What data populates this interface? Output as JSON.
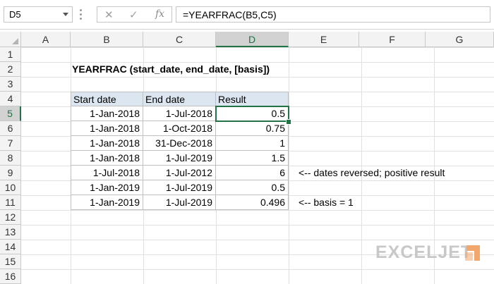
{
  "formula_bar": {
    "name_box": "D5",
    "cancel_icon": "✕",
    "enter_icon": "✓",
    "fx_label": "fx",
    "formula": "=YEARFRAC(B5,C5)"
  },
  "columns": [
    "A",
    "B",
    "C",
    "D",
    "E",
    "F",
    "G"
  ],
  "rows": [
    "1",
    "2",
    "3",
    "4",
    "5",
    "6",
    "7",
    "8",
    "9",
    "10",
    "11",
    "12",
    "13",
    "14",
    "15",
    "16"
  ],
  "title": "YEARFRAC (start_date, end_date, [basis])",
  "table": {
    "headers": [
      "Start date",
      "End date",
      "Result"
    ],
    "rows": [
      {
        "start": "1-Jan-2018",
        "end": "1-Jul-2018",
        "result": "0.5"
      },
      {
        "start": "1-Jan-2018",
        "end": "1-Oct-2018",
        "result": "0.75"
      },
      {
        "start": "1-Jan-2018",
        "end": "31-Dec-2018",
        "result": "1"
      },
      {
        "start": "1-Jan-2018",
        "end": "1-Jul-2019",
        "result": "1.5"
      },
      {
        "start": "1-Jul-2018",
        "end": "1-Jul-2012",
        "result": "6"
      },
      {
        "start": "1-Jan-2019",
        "end": "1-Jul-2019",
        "result": "0.5"
      },
      {
        "start": "1-Jan-2019",
        "end": "1-Jul-2019",
        "result": "0.496"
      }
    ]
  },
  "notes": {
    "row9": "<-- dates reversed; positive result",
    "row11": "<-- basis = 1"
  },
  "selection": {
    "column": "D",
    "row": "5"
  },
  "watermark": "EXCELJET",
  "colors": {
    "accent": "#217346",
    "header_fill": "#dce6f1",
    "logo": "#c8c8c8",
    "logo_mark": "#f2a76c"
  }
}
